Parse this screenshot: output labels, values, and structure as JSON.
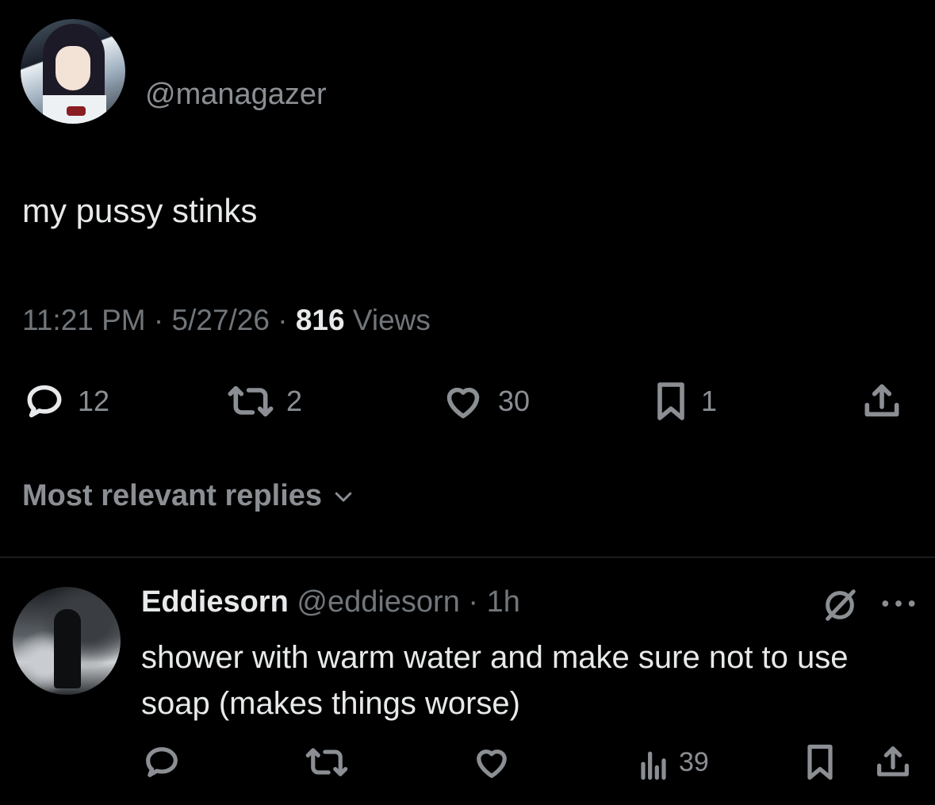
{
  "tweet": {
    "handle": "@managazer",
    "text": "my pussy stinks",
    "time": "11:21 PM",
    "date": "5/27/26",
    "views_count": "816",
    "views_label": "Views",
    "stats": {
      "replies": "12",
      "reposts": "2",
      "likes": "30",
      "bookmarks": "1"
    }
  },
  "replies_sort": {
    "label": "Most relevant replies"
  },
  "reply": {
    "name": "Eddiesorn",
    "handle": "@eddiesorn",
    "age": "1h",
    "text": "shower with warm water and make sure not to use soap (makes things worse)",
    "views": "39"
  },
  "icons": {
    "reply": "reply-icon",
    "repost": "repost-icon",
    "like": "heart-icon",
    "bookmark": "bookmark-icon",
    "share": "share-icon",
    "views": "views-icon",
    "grok": "grok-icon",
    "more": "more-icon",
    "chevron": "chevron-down-icon"
  },
  "colors": {
    "background": "#000000",
    "text": "#e7e9ea",
    "muted": "#71767b",
    "divider": "#2f3336"
  }
}
